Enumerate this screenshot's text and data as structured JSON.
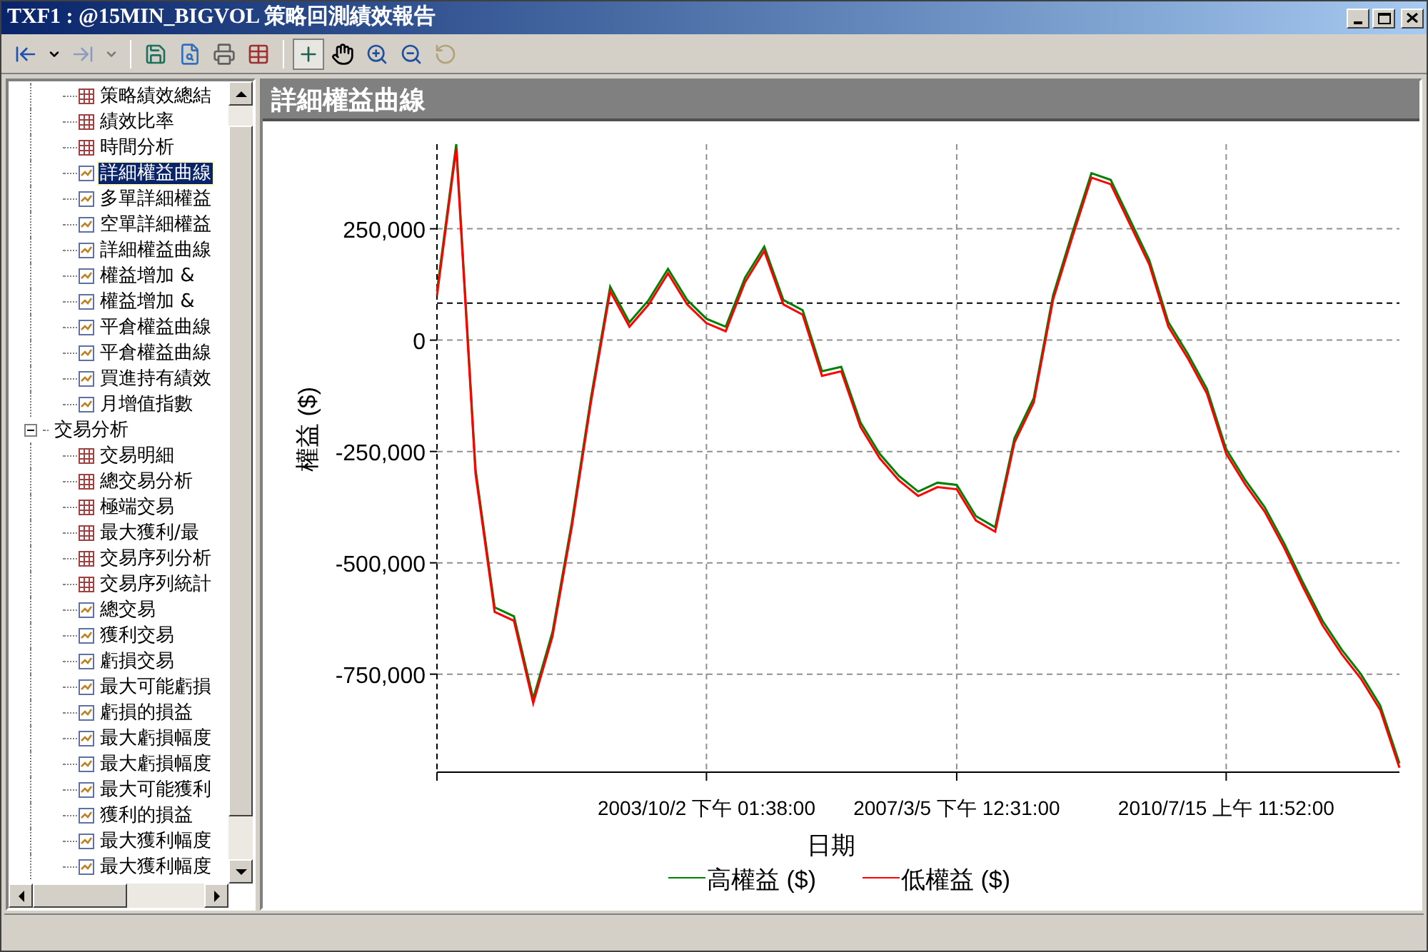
{
  "window": {
    "title": "TXF1 : @15MIN_BIGVOL 策略回測績效報告"
  },
  "toolbar": [
    {
      "kind": "back",
      "disabled": false
    },
    {
      "kind": "dropdown",
      "disabled": false
    },
    {
      "kind": "forward",
      "disabled": true
    },
    {
      "kind": "dropdown",
      "disabled": true
    },
    {
      "kind": "separator"
    },
    {
      "kind": "save",
      "disabled": false
    },
    {
      "kind": "preview",
      "disabled": false
    },
    {
      "kind": "print",
      "disabled": false
    },
    {
      "kind": "table",
      "disabled": false
    },
    {
      "kind": "separator"
    },
    {
      "kind": "crosshair",
      "disabled": false,
      "pressed": true
    },
    {
      "kind": "hand",
      "disabled": false,
      "pressed": false
    },
    {
      "kind": "zoom-in",
      "disabled": false,
      "pressed": false
    },
    {
      "kind": "zoom-out",
      "disabled": false,
      "pressed": false
    },
    {
      "kind": "undo",
      "disabled": true,
      "pressed": false
    }
  ],
  "tree": [
    {
      "children": [
        {
          "label": "策略績效總結",
          "kind": "table",
          "selected": false
        },
        {
          "label": "績效比率",
          "kind": "table",
          "selected": false
        },
        {
          "label": "時間分析",
          "kind": "table",
          "selected": false
        },
        {
          "label": "詳細權益曲線",
          "kind": "chart",
          "selected": true
        },
        {
          "label": "多單詳細權益",
          "kind": "chart",
          "selected": false
        },
        {
          "label": "空單詳細權益",
          "kind": "chart",
          "selected": false
        },
        {
          "label": "詳細權益曲線",
          "kind": "chart",
          "selected": false
        },
        {
          "label": "權益增加 &",
          "kind": "chart",
          "selected": false
        },
        {
          "label": "權益增加 &",
          "kind": "chart",
          "selected": false
        },
        {
          "label": "平倉權益曲線",
          "kind": "chart",
          "selected": false
        },
        {
          "label": "平倉權益曲線",
          "kind": "chart",
          "selected": false
        },
        {
          "label": "買進持有績效",
          "kind": "chart",
          "selected": false
        },
        {
          "label": "月增值指數",
          "kind": "chart",
          "selected": false
        }
      ]
    },
    {
      "label": "交易分析",
      "expanded": true,
      "children": [
        {
          "label": "交易明細",
          "kind": "table",
          "selected": false
        },
        {
          "label": "總交易分析",
          "kind": "table",
          "selected": false
        },
        {
          "label": "極端交易",
          "kind": "table",
          "selected": false
        },
        {
          "label": "最大獲利/最",
          "kind": "table",
          "selected": false
        },
        {
          "label": "交易序列分析",
          "kind": "table",
          "selected": false
        },
        {
          "label": "交易序列統計",
          "kind": "table",
          "selected": false
        },
        {
          "label": "總交易",
          "kind": "chart",
          "selected": false
        },
        {
          "label": "獲利交易",
          "kind": "chart",
          "selected": false
        },
        {
          "label": "虧損交易",
          "kind": "chart",
          "selected": false
        },
        {
          "label": "最大可能虧損",
          "kind": "chart",
          "selected": false
        },
        {
          "label": "虧損的損益",
          "kind": "chart",
          "selected": false
        },
        {
          "label": "最大虧損幅度",
          "kind": "chart",
          "selected": false
        },
        {
          "label": "最大虧損幅度",
          "kind": "chart",
          "selected": false
        },
        {
          "label": "最大可能獲利",
          "kind": "chart",
          "selected": false
        },
        {
          "label": "獲利的損益",
          "kind": "chart",
          "selected": false
        },
        {
          "label": "最大獲利幅度",
          "kind": "chart",
          "selected": false
        },
        {
          "label": "最大獲利幅度",
          "kind": "chart",
          "selected": false
        }
      ]
    }
  ],
  "panel": {
    "title": "詳細權益曲線",
    "chart_data": {
      "type": "line",
      "xlabel": "日期",
      "ylabel": "權益 ($)",
      "categories": [
        null,
        null,
        null,
        null,
        null,
        null,
        null,
        null,
        null,
        null,
        null,
        null,
        null,
        null,
        "2003/10/2 下午 01:38:00",
        null,
        null,
        null,
        null,
        null,
        null,
        null,
        null,
        null,
        null,
        null,
        null,
        "2007/3/5 下午 12:31:00",
        null,
        null,
        null,
        null,
        null,
        null,
        null,
        null,
        null,
        null,
        null,
        null,
        null,
        "2010/7/15 上午 11:52:00",
        null,
        null,
        null,
        null,
        null,
        null,
        null,
        null,
        null
      ],
      "series": [
        {
          "color": "#000000",
          "line_style": "dashed",
          "values": [
            83000,
            83000,
            83000,
            83000,
            83000,
            83000,
            83000,
            83000,
            83000,
            83000,
            83000,
            83000,
            83000,
            83000,
            83000,
            83000,
            83000,
            83000,
            83000,
            83000,
            83000,
            83000,
            83000,
            83000,
            83000,
            83000,
            83000,
            83000,
            83000,
            83000,
            83000,
            83000,
            83000,
            83000,
            83000,
            83000,
            83000,
            83000,
            83000,
            83000,
            83000,
            83000,
            83000,
            83000,
            83000,
            83000,
            83000,
            83000,
            83000,
            83000,
            83000
          ]
        },
        {
          "name": "高權益 ($)",
          "color": "#008000",
          "values": [
            110000,
            440000,
            -290000,
            -600000,
            -620000,
            -805000,
            -655000,
            -410000,
            -130000,
            120000,
            40000,
            90000,
            160000,
            90000,
            48000,
            30000,
            140000,
            210000,
            90000,
            67000,
            -70000,
            -60000,
            -185000,
            -255000,
            -305000,
            -340000,
            -320000,
            -325000,
            -395000,
            -420000,
            -220000,
            -130000,
            100000,
            240000,
            375000,
            360000,
            270000,
            180000,
            40000,
            -30000,
            -110000,
            -245000,
            -315000,
            -375000,
            -455000,
            -545000,
            -630000,
            -695000,
            -750000,
            -820000,
            -950000
          ]
        },
        {
          "name": "低權益 ($)",
          "color": "#ff0000",
          "values": [
            100000,
            430000,
            -300000,
            -610000,
            -630000,
            -815000,
            -665000,
            -420000,
            -140000,
            110000,
            30000,
            80000,
            150000,
            80000,
            38000,
            20000,
            130000,
            200000,
            80000,
            57000,
            -80000,
            -70000,
            -195000,
            -265000,
            -315000,
            -350000,
            -330000,
            -335000,
            -405000,
            -430000,
            -230000,
            -140000,
            90000,
            230000,
            365000,
            350000,
            260000,
            170000,
            30000,
            -40000,
            -120000,
            -255000,
            -325000,
            -385000,
            -465000,
            -555000,
            -640000,
            -705000,
            -760000,
            -830000,
            -960000
          ]
        }
      ],
      "ylim": [
        -970000,
        440000
      ],
      "yticks": [
        {
          "value": 250000,
          "label": "250,000"
        },
        {
          "value": 0,
          "label": "0"
        },
        {
          "value": -250000,
          "label": "-250,000"
        },
        {
          "value": -500000,
          "label": "-500,000"
        },
        {
          "value": -750000,
          "label": "-750,000"
        }
      ],
      "grid": true,
      "legend": "bottom"
    }
  }
}
